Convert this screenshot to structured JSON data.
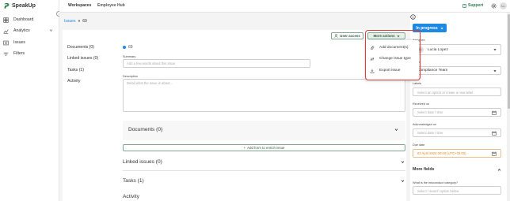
{
  "brand": {
    "name": "SpeakUp"
  },
  "sidebar": {
    "items": [
      {
        "label": "Dashboard"
      },
      {
        "label": "Analytics"
      },
      {
        "label": "Issues"
      },
      {
        "label": "Filters"
      }
    ]
  },
  "topbar": {
    "tabs": [
      {
        "label": "Workspaces"
      },
      {
        "label": "Employee Hub"
      }
    ],
    "support_label": "Support",
    "avatar_initials": "LL"
  },
  "breadcrumb": {
    "parent": "Issues",
    "current": "69"
  },
  "left_nav": {
    "items": [
      {
        "label": "Documents (0)"
      },
      {
        "label": "Linked issues (0)"
      },
      {
        "label": "Tasks (1)"
      },
      {
        "label": "Activity"
      }
    ]
  },
  "issue": {
    "number": "69",
    "summary_label": "Summary",
    "summary_placeholder": "Add a few words about this issue",
    "description_label": "Description",
    "description_placeholder": "Detail what the issue is about..."
  },
  "toolbar": {
    "user_access_label": "User access",
    "more_actions_label": "More actions"
  },
  "more_actions_menu": {
    "items": [
      {
        "label": "Add document(s)"
      },
      {
        "label": "Change issue type"
      },
      {
        "label": "Export issue"
      }
    ]
  },
  "sections": {
    "documents_title": "Documents (0)",
    "add_form_label": "Add form to enrich issue",
    "linked_title": "Linked issues (0)",
    "tasks_title": "Tasks (1)",
    "activity_title": "Activity"
  },
  "right_panel": {
    "status_label": "In progress",
    "assignee_label": "Assignee",
    "assignee_name": "Lucia Lopez",
    "assignee_initials": "LL",
    "team_label": "Team",
    "team_name": "Compliance Team",
    "labels_label": "Labels",
    "labels_placeholder": "Select an option or create a new label",
    "received_label": "Received on",
    "received_placeholder": "Select date / time",
    "acknowledged_label": "Acknowledged on",
    "acknowledged_placeholder": "Select date / time",
    "due_label": "Due date",
    "due_value": "03 April 2024 00:00 (UTC+02:00)",
    "more_fields_label": "More fields",
    "misconduct_label": "What is the misconduct category?",
    "misconduct_placeholder": "Select / search option below"
  },
  "colors": {
    "accent_blue": "#1e88e5",
    "dropdown_highlight": "#e53935",
    "green_border": "#7fa58e",
    "due_date_text": "#e08a1e"
  }
}
